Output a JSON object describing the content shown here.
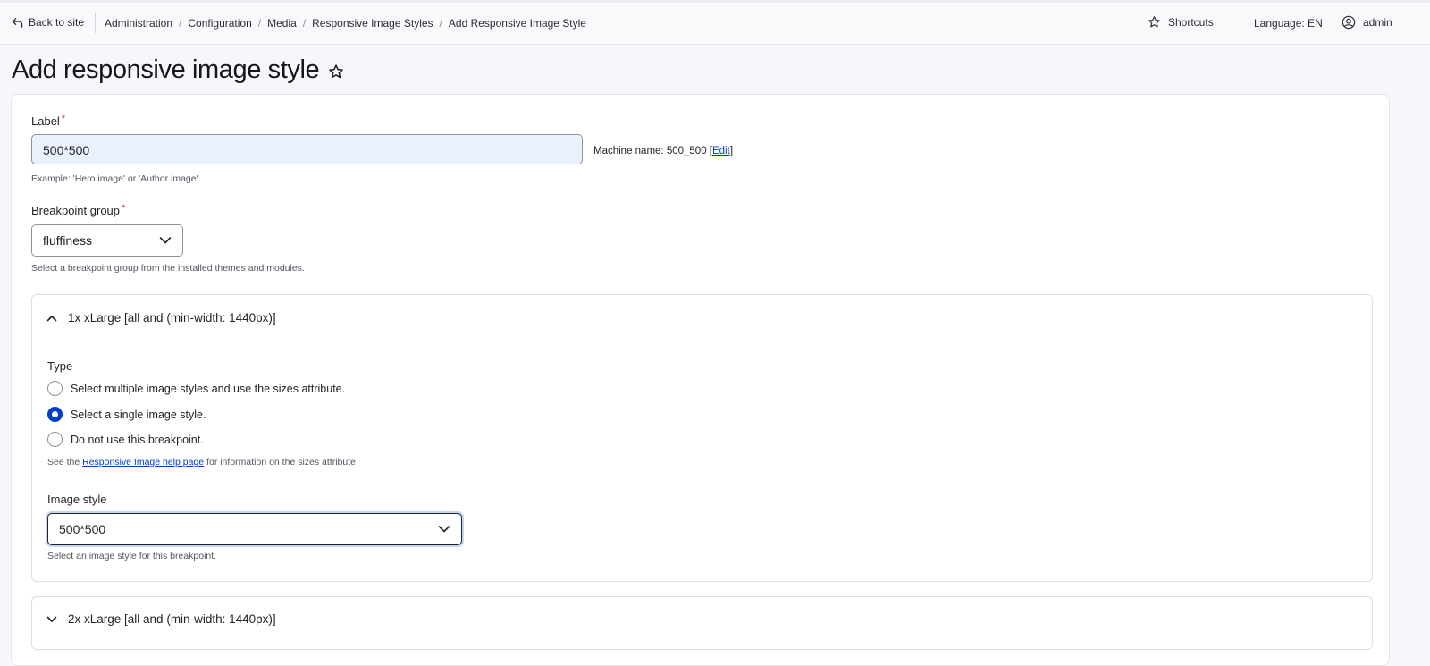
{
  "toolbar": {
    "back_label": "Back to site",
    "breadcrumbs": [
      "Administration",
      "Configuration",
      "Media",
      "Responsive Image Styles",
      "Add Responsive Image Style"
    ],
    "shortcuts_label": "Shortcuts",
    "language_label": "Language: EN",
    "user_label": "admin"
  },
  "page": {
    "title": "Add responsive image style"
  },
  "form": {
    "label_field": {
      "label": "Label",
      "required_mark": "*",
      "value": "500*500",
      "machine_prefix": "Machine name: 500_500 [",
      "machine_edit": "Edit",
      "machine_suffix": "]",
      "description": "Example: 'Hero image' or 'Author image'."
    },
    "breakpoint_group": {
      "label": "Breakpoint group",
      "required_mark": "*",
      "value": "fluffiness",
      "description": "Select a breakpoint group from the installed themes and modules."
    },
    "breakpoint_1": {
      "summary": "1x xLarge [all and (min-width: 1440px)]",
      "type_label": "Type",
      "options": [
        "Select multiple image styles and use the sizes attribute.",
        "Select a single image style.",
        "Do not use this breakpoint."
      ],
      "selected_index": 1,
      "help_prefix": "See the ",
      "help_link": "Responsive Image help page",
      "help_suffix": " for information on the sizes attribute.",
      "image_style_label": "Image style",
      "image_style_value": "500*500",
      "image_style_description": "Select an image style for this breakpoint."
    },
    "breakpoint_2": {
      "summary": "2x xLarge [all and (min-width: 1440px)]"
    }
  },
  "colors": {
    "accent": "#003ecc",
    "required": "#d72222",
    "input_fill": "#eaf0fd"
  }
}
